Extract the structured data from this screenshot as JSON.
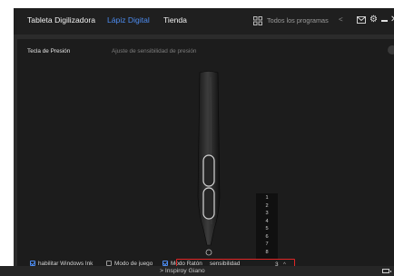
{
  "tabs": [
    {
      "label": "Tableta Digilizadora",
      "active": false
    },
    {
      "label": "Lápiz Digital",
      "active": true
    },
    {
      "label": "Tienda",
      "active": false
    }
  ],
  "header": {
    "programs_label": "Todos los programas",
    "programs_arrow": "<",
    "icons": [
      "grid-icon",
      "mail-icon",
      "gear-icon",
      "minimize-icon",
      "close-icon"
    ]
  },
  "subtabs": [
    {
      "label": "Tecla de Presión",
      "active": true
    },
    {
      "label": "Ajuste de sensibilidad de presión",
      "active": false
    }
  ],
  "options": {
    "windows_ink": {
      "label": "habilitar Windows Ink",
      "checked": true
    },
    "game_mode": {
      "label": "Modo de juego",
      "checked": false
    },
    "mouse_mode": {
      "label": "Modo Ratón",
      "checked": true
    },
    "sensitivity_label": "sensibilidad",
    "sensitivity_value": "3",
    "sensitivity_caret": "^",
    "sensitivity_options": [
      "1",
      "2",
      "3",
      "4",
      "5",
      "6",
      "7",
      "8"
    ]
  },
  "device": {
    "name": "Inspiroy Giano",
    "prefix": ">"
  },
  "colors": {
    "accent": "#4d8cf0",
    "highlight": "#e02626",
    "background": "#1c1c1c"
  }
}
